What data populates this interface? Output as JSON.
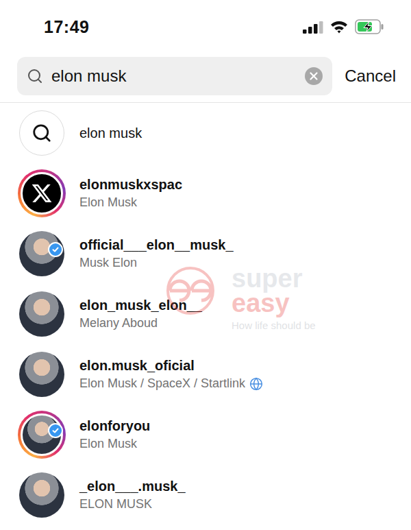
{
  "status_bar": {
    "time": "17:49",
    "signal_level": 0.75,
    "wifi": true,
    "battery": {
      "level": 0.7,
      "charging": true
    }
  },
  "search": {
    "query": "elon musk",
    "cancel": "Cancel"
  },
  "suggestion": {
    "text": "elon musk"
  },
  "results": [
    {
      "username": "elonmuskxspac",
      "name": "Elon Musk",
      "kind": "logo",
      "story": true,
      "verified": false,
      "globe": false
    },
    {
      "username": "official___elon__musk_",
      "name": "Musk Elon",
      "kind": "photo",
      "story": false,
      "verified": true,
      "globe": false
    },
    {
      "username": "elon_musk_elon__",
      "name": "Melany Aboud",
      "kind": "photo",
      "story": false,
      "verified": false,
      "globe": false
    },
    {
      "username": "elon.musk_oficial",
      "name": "Elon Musk / SpaceX / Startlink",
      "kind": "photo",
      "story": false,
      "verified": false,
      "globe": true
    },
    {
      "username": "elonforyou",
      "name": "Elon Musk",
      "kind": "photo",
      "story": true,
      "verified": true,
      "globe": false
    },
    {
      "username": "_elon___.musk_",
      "name": "ELON MUSK",
      "kind": "photo",
      "story": false,
      "verified": false,
      "globe": false
    }
  ],
  "watermark": {
    "brand": [
      "super",
      "easy"
    ],
    "tagline": "How life should be"
  }
}
